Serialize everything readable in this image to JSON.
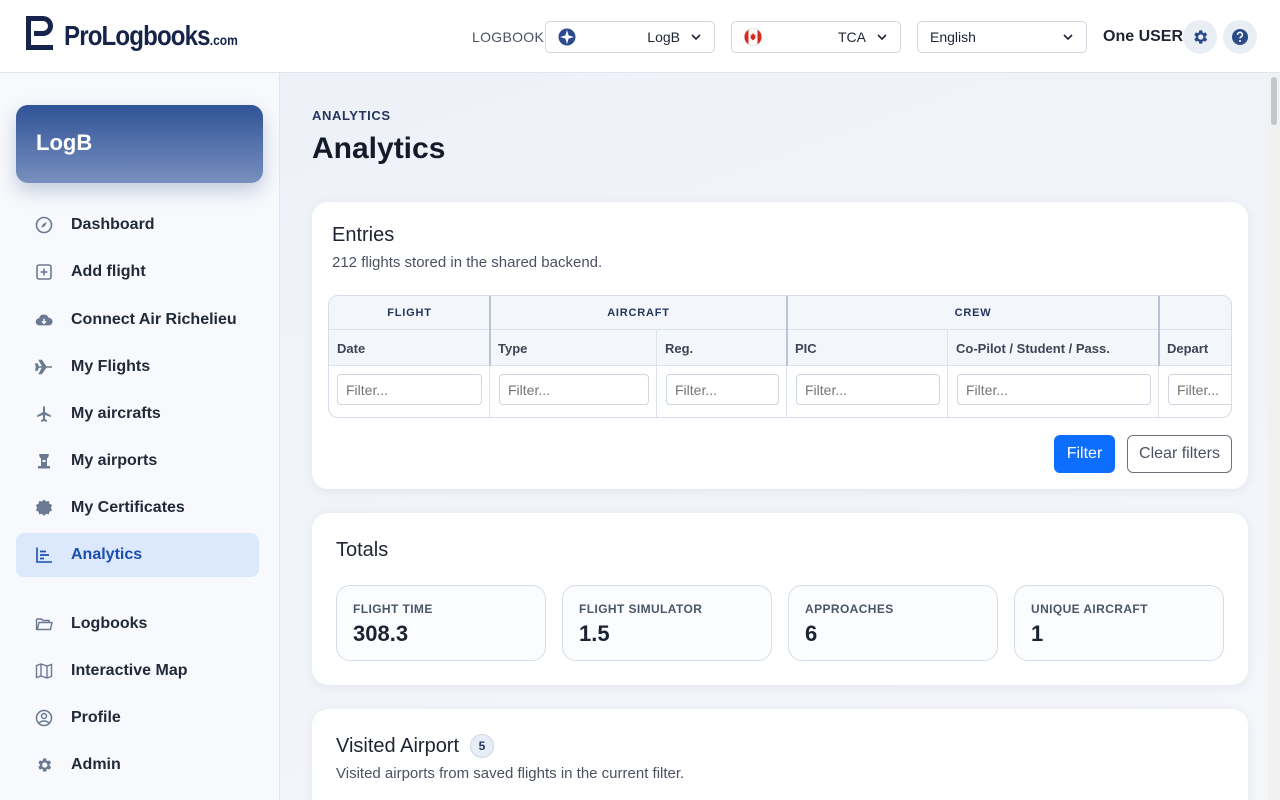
{
  "header": {
    "logo_text": "ProLogbooks",
    "logo_suffix": ".com",
    "logbook_label": "LOGBOOK",
    "logbook_value": "LogB",
    "authority_value": "TCA",
    "language_value": "English",
    "user_name": "One USER"
  },
  "sidebar": {
    "brand": "LogB",
    "items": [
      {
        "label": "Dashboard",
        "icon": "compass-icon"
      },
      {
        "label": "Add flight",
        "icon": "plus-square-icon"
      },
      {
        "label": "Connect Air Richelieu",
        "icon": "cloud-download-icon"
      },
      {
        "label": "My Flights",
        "icon": "airplane-icon"
      },
      {
        "label": "My aircrafts",
        "icon": "aircraft-icon"
      },
      {
        "label": "My airports",
        "icon": "control-tower-icon"
      },
      {
        "label": "My Certificates",
        "icon": "certificate-badge-icon"
      },
      {
        "label": "Analytics",
        "icon": "chart-icon"
      },
      {
        "label": "Logbooks",
        "icon": "folder-icon"
      },
      {
        "label": "Interactive Map",
        "icon": "map-icon"
      },
      {
        "label": "Profile",
        "icon": "user-circle-icon"
      },
      {
        "label": "Admin",
        "icon": "gear-icon"
      }
    ],
    "active": "Analytics"
  },
  "page": {
    "eyebrow": "ANALYTICS",
    "title": "Analytics"
  },
  "entries": {
    "title": "Entries",
    "subtitle": "212 flights stored in the shared backend.",
    "groups": [
      "FLIGHT",
      "AIRCRAFT",
      "CREW"
    ],
    "columns": [
      "Date",
      "Type",
      "Reg.",
      "PIC",
      "Co-Pilot / Student / Pass.",
      "Depart"
    ],
    "filter_placeholder": "Filter...",
    "filter_button": "Filter",
    "clear_button": "Clear filters"
  },
  "totals": {
    "title": "Totals",
    "stats": [
      {
        "label": "FLIGHT TIME",
        "value": "308.3"
      },
      {
        "label": "FLIGHT SIMULATOR",
        "value": "1.5"
      },
      {
        "label": "APPROACHES",
        "value": "6"
      },
      {
        "label": "UNIQUE AIRCRAFT",
        "value": "1"
      }
    ]
  },
  "visited": {
    "title": "Visited Airport",
    "count": "5",
    "subtitle": "Visited airports from saved flights in the current filter."
  },
  "colors": {
    "primary": "#0d6efd",
    "brand_navy": "#16234a",
    "active_nav_bg": "#dce8fb"
  }
}
